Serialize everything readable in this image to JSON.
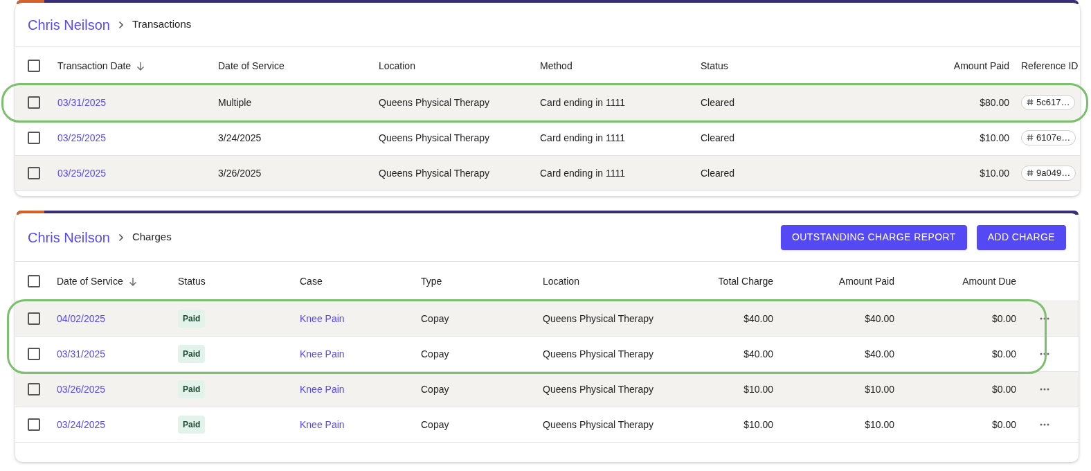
{
  "transactions": {
    "breadcrumb": {
      "parent": "Chris Neilson",
      "current": "Transactions"
    },
    "columns": [
      "Transaction Date",
      "Date of Service",
      "Location",
      "Method",
      "Status",
      "Amount Paid",
      "Reference ID"
    ],
    "select_all": {
      "checked": false
    },
    "rows": [
      {
        "checked": false,
        "highlighted": true,
        "transaction_date": "03/31/2025",
        "date_of_service": "Multiple",
        "location": "Queens Physical Therapy",
        "method": "Card ending in 1111",
        "status": "Cleared",
        "amount_paid": "$80.00",
        "reference_id": "5c617…"
      },
      {
        "checked": false,
        "highlighted": false,
        "transaction_date": "03/25/2025",
        "date_of_service": "3/24/2025",
        "location": "Queens Physical Therapy",
        "method": "Card ending in 1111",
        "status": "Cleared",
        "amount_paid": "$10.00",
        "reference_id": "6107e…"
      },
      {
        "checked": false,
        "highlighted": false,
        "transaction_date": "03/25/2025",
        "date_of_service": "3/26/2025",
        "location": "Queens Physical Therapy",
        "method": "Card ending in 1111",
        "status": "Cleared",
        "amount_paid": "$10.00",
        "reference_id": "9a049…"
      }
    ]
  },
  "charges": {
    "breadcrumb": {
      "parent": "Chris Neilson",
      "current": "Charges"
    },
    "buttons": [
      "OUTSTANDING CHARGE REPORT",
      "ADD CHARGE"
    ],
    "columns": [
      "Date of Service",
      "Status",
      "Case",
      "Type",
      "Location",
      "Total Charge",
      "Amount Paid",
      "Amount Due"
    ],
    "select_all": {
      "checked": false
    },
    "rows": [
      {
        "checked": false,
        "highlighted": true,
        "date_of_service": "04/02/2025",
        "status": "Paid",
        "case": "Knee Pain",
        "type": "Copay",
        "location": "Queens Physical Therapy",
        "total_charge": "$40.00",
        "amount_paid": "$40.00",
        "amount_due": "$0.00"
      },
      {
        "checked": false,
        "highlighted": true,
        "date_of_service": "03/31/2025",
        "status": "Paid",
        "case": "Knee Pain",
        "type": "Copay",
        "location": "Queens Physical Therapy",
        "total_charge": "$40.00",
        "amount_paid": "$40.00",
        "amount_due": "$0.00"
      },
      {
        "checked": false,
        "highlighted": false,
        "date_of_service": "03/26/2025",
        "status": "Paid",
        "case": "Knee Pain",
        "type": "Copay",
        "location": "Queens Physical Therapy",
        "total_charge": "$10.00",
        "amount_paid": "$10.00",
        "amount_due": "$0.00"
      },
      {
        "checked": false,
        "highlighted": false,
        "date_of_service": "03/24/2025",
        "status": "Paid",
        "case": "Knee Pain",
        "type": "Copay",
        "location": "Queens Physical Therapy",
        "total_charge": "$10.00",
        "amount_paid": "$10.00",
        "amount_due": "$0.00"
      }
    ]
  }
}
